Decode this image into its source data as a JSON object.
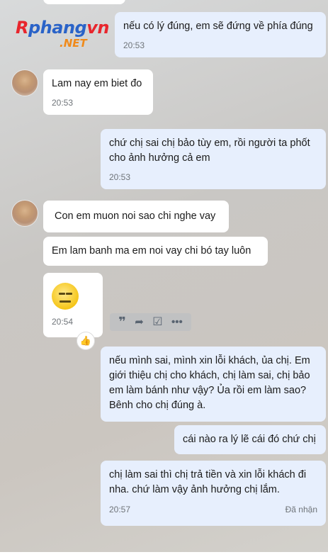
{
  "watermark": {
    "main": "Rphangvn",
    "sub": ".NET"
  },
  "messages": [
    {
      "text": "nếu có lý đúng, em sẽ đứng về phía đúng",
      "time": "20:53"
    },
    {
      "text": "Lam nay em biet đo",
      "time": "20:53"
    },
    {
      "text": "chứ chị sai chị bảo tùy em, rồi người ta phốt cho ảnh hưởng cả em",
      "time": "20:53"
    },
    {
      "text": "Con em muon noi sao chi nghe vay"
    },
    {
      "text": "Em lam banh ma em noi vay chi bó tay luôn"
    },
    {
      "time": "20:54"
    },
    {
      "text": "nếu mình sai, mình xin lỗi khách, ủa chị. Em giới thiệu chị cho khách, chị làm sai, chị bảo em làm bánh như vậy? Ủa rồi em làm sao? Bênh cho chị đúng à."
    },
    {
      "text": "cái nào ra lý lẽ cái đó chứ chị"
    },
    {
      "text": "chị làm sai thì chị trả tiền và xin lỗi khách đi nha. chứ làm vậy ảnh hưởng chị lắm.",
      "time": "20:57",
      "status": "Đã nhận"
    }
  ],
  "icons": [
    "avatar",
    "neutral-face-emoji",
    "quote-icon",
    "share-icon",
    "task-icon",
    "more-icon",
    "like-icon"
  ]
}
